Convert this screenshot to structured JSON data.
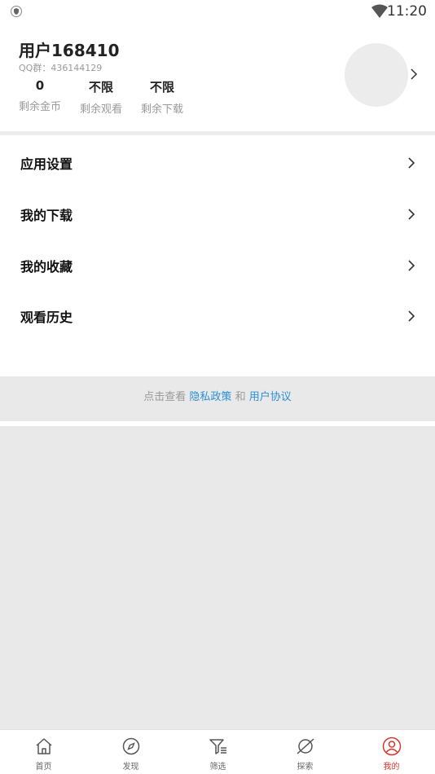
{
  "status_bar": {
    "time": "11:20"
  },
  "profile": {
    "username": "用户168410",
    "qq_group": "QQ群：436144129",
    "stats": [
      {
        "value": "0",
        "label": "剩余金币"
      },
      {
        "value": "不限",
        "label": "剩余观看"
      },
      {
        "value": "不限",
        "label": "剩余下载"
      }
    ]
  },
  "menu": [
    {
      "label": "应用设置"
    },
    {
      "label": "我的下载"
    },
    {
      "label": "我的收藏"
    },
    {
      "label": "观看历史"
    }
  ],
  "footer": {
    "prefix": "点击查看",
    "privacy_link": "隐私政策",
    "and": "和",
    "agreement_link": "用户协议"
  },
  "tabs": [
    {
      "label": "首页",
      "icon": "home-icon"
    },
    {
      "label": "发现",
      "icon": "compass-icon"
    },
    {
      "label": "筛选",
      "icon": "filter-icon"
    },
    {
      "label": "探索",
      "icon": "planet-icon"
    },
    {
      "label": "我的",
      "icon": "user-icon",
      "active": true
    }
  ],
  "colors": {
    "accent": "#d9342b",
    "link": "#2b8fd6",
    "background": "#e9e9e9"
  }
}
